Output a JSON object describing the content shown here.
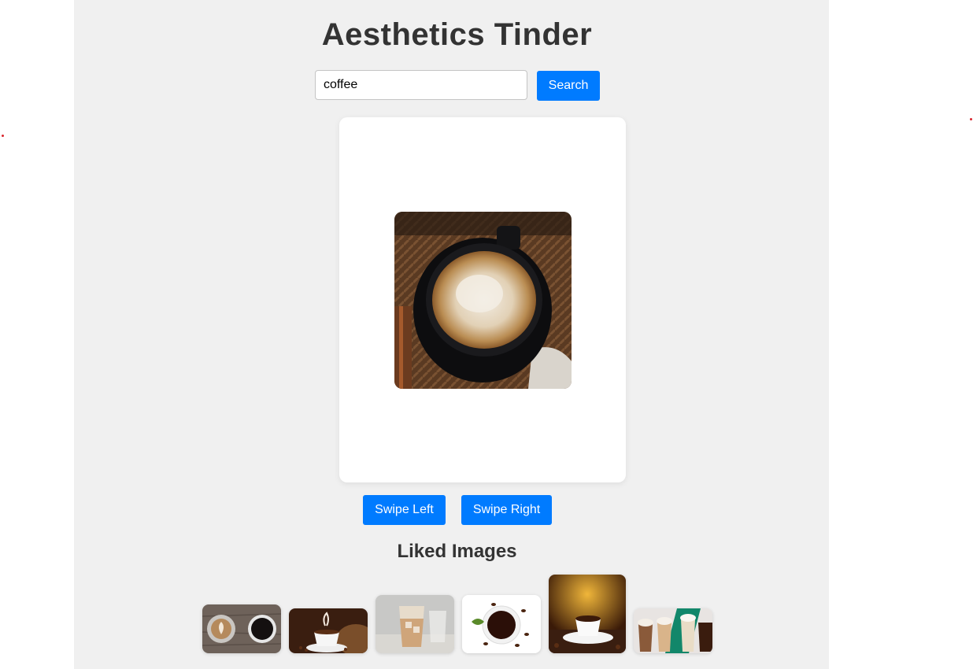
{
  "header": {
    "title": "Aesthetics Tinder"
  },
  "search": {
    "value": "coffee",
    "button_label": "Search"
  },
  "card": {
    "image_icon": "coffee-cup-photo"
  },
  "actions": {
    "swipe_left_label": "Swipe Left",
    "swipe_right_label": "Swipe Right"
  },
  "liked": {
    "title": "Liked Images",
    "images": [
      {
        "icon": "latte-art-and-black-coffee-photo"
      },
      {
        "icon": "coffee-cup-with-beans-photo"
      },
      {
        "icon": "iced-latte-photo"
      },
      {
        "icon": "black-coffee-with-beans-photo"
      },
      {
        "icon": "coffee-cup-warm-light-photo"
      },
      {
        "icon": "frappuccino-drinks-photo"
      }
    ]
  },
  "colors": {
    "accent": "#007bff",
    "page_background": "#f0f0f0",
    "text": "#333333"
  }
}
